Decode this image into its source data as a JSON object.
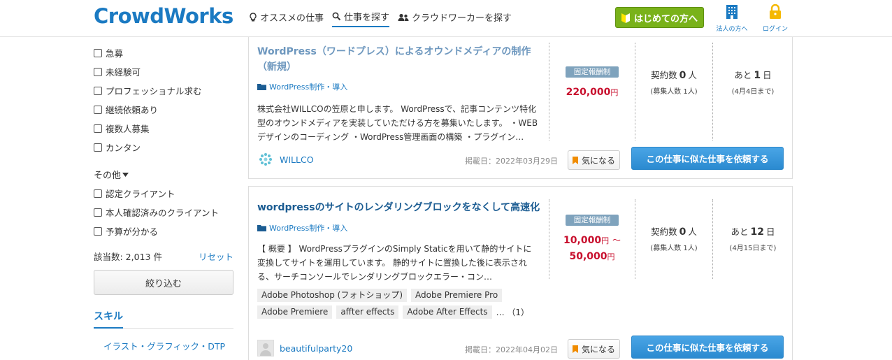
{
  "header": {
    "logo": "CrowdWorks",
    "nav": [
      {
        "label": "オススメの仕事",
        "icon": "lightbulb-icon"
      },
      {
        "label": "仕事を探す",
        "icon": "search-icon"
      },
      {
        "label": "クラウドワーカーを探す",
        "icon": "users-icon"
      }
    ],
    "hajimete_label": "はじめての方へ",
    "corporate_label": "法人の方へ",
    "login_label": "ログイン"
  },
  "sidebar": {
    "checkboxes_a": [
      {
        "label": "急募"
      },
      {
        "label": "未経験可"
      },
      {
        "label": "プロフェッショナル求む"
      },
      {
        "label": "継続依頼あり"
      },
      {
        "label": "複数人募集"
      },
      {
        "label": "カンタン"
      }
    ],
    "other_title": "その他",
    "checkboxes_b": [
      {
        "label": "認定クライアント"
      },
      {
        "label": "本人確認済みのクライアント"
      },
      {
        "label": "予算が分かる"
      }
    ],
    "result_count": "該当数: 2,013 件",
    "reset_label": "リセット",
    "filter_button": "絞り込む",
    "skill_title": "スキル",
    "skill_item": "イラスト・グラフィック・DTP"
  },
  "jobs": [
    {
      "title": "WordPress（ワードプレス）によるオウンドメディアの制作（新規）",
      "category": "WordPress制作・導入",
      "description": "株式会社WILLCOの笠原と申します。 WordPressで、記事コンテンツ特化型のオウンドメディアを実装していただける方を募集いたします。 ・WEBデザインのコーディング ・WordPress管理画面の構築 ・プラグイン…",
      "badge": "固定報酬制",
      "price_min": "220,000",
      "price_max": "",
      "yen": "円",
      "tilde": "〜",
      "contract_label": "契約数",
      "contract_num": "0",
      "contract_unit": "人",
      "recruit": "(募集人数 1人)",
      "remaining_prefix": "あと",
      "remaining_days": "1",
      "remaining_unit": "日",
      "deadline": "(4月4日まで)",
      "client": "WILLCO",
      "posted": "掲載日：2022年03月29日",
      "fav_label": "気になる",
      "request_label": "この仕事に似た仕事を依頼する",
      "tags": [],
      "more": ""
    },
    {
      "title": "wordpressのサイトのレンダリングブロックをなくして高速化",
      "category": "WordPress制作・導入",
      "description": "【 概要 】 WordPressプラグインのSimply Staticを用いて静的サイトに変換してサイトを運用しています。 静的サイトに置換した後に表示される、サーチコンソールでレンダリングブロックエラー・コン…",
      "badge": "固定報酬制",
      "price_min": "10,000",
      "price_max": "50,000",
      "yen": "円",
      "tilde": "〜",
      "contract_label": "契約数",
      "contract_num": "0",
      "contract_unit": "人",
      "recruit": "(募集人数 1人)",
      "remaining_prefix": "あと",
      "remaining_days": "12",
      "remaining_unit": "日",
      "deadline": "(4月15日まで)",
      "client": "beautifulparty20",
      "posted": "掲載日：2022年04月02日",
      "fav_label": "気になる",
      "request_label": "この仕事に似た仕事を依頼する",
      "tags": [
        "Adobe Photoshop (フォトショップ)",
        "Adobe Premiere Pro",
        "Adobe Premiere",
        "affter effects",
        "Adobe After Effects"
      ],
      "more": "… （1）"
    }
  ],
  "colors": {
    "brand": "#1b7ac2",
    "price": "#c8102e",
    "green": "#79b21a"
  }
}
